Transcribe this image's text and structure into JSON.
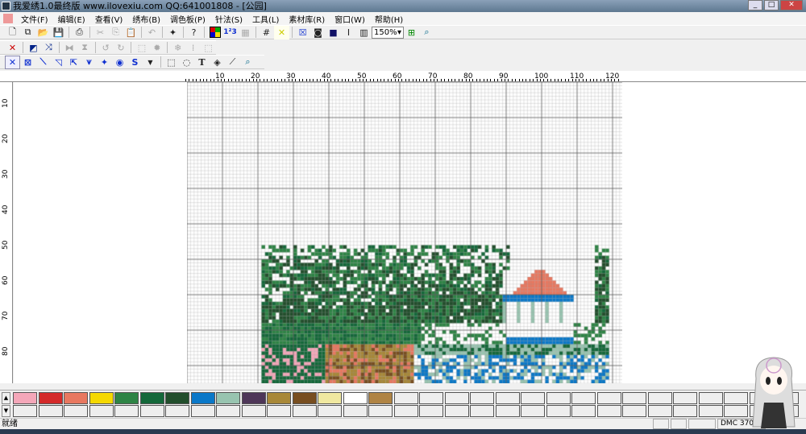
{
  "window": {
    "title": "我爱绣1.0最终版 www.ilovexiu.com QQ:641001808 - [公园]"
  },
  "menu": [
    "文件(F)",
    "编辑(E)",
    "查看(V)",
    "绣布(B)",
    "调色板(P)",
    "针法(S)",
    "工具(L)",
    "素材库(R)",
    "窗口(W)",
    "帮助(H)"
  ],
  "toolbar": {
    "zoom": "150%"
  },
  "ruler": {
    "top": [
      "10",
      "20",
      "30",
      "40",
      "50",
      "60",
      "70",
      "80",
      "90",
      "100",
      "110",
      "120"
    ],
    "left": [
      "10",
      "20",
      "30",
      "40",
      "50",
      "60",
      "70",
      "80"
    ]
  },
  "palette": {
    "colors": [
      "#f4a7b9",
      "#d42a2a",
      "#e87860",
      "#f5d800",
      "#2e8445",
      "#14683a",
      "#224e2c",
      "#0a78c8",
      "#98c4b0",
      "#4e3658",
      "#a88838",
      "#784e20",
      "#f0e8a0",
      "#ffffff",
      "#b08444"
    ]
  },
  "status": {
    "text": "就绪",
    "thread": "DMC  3708"
  }
}
